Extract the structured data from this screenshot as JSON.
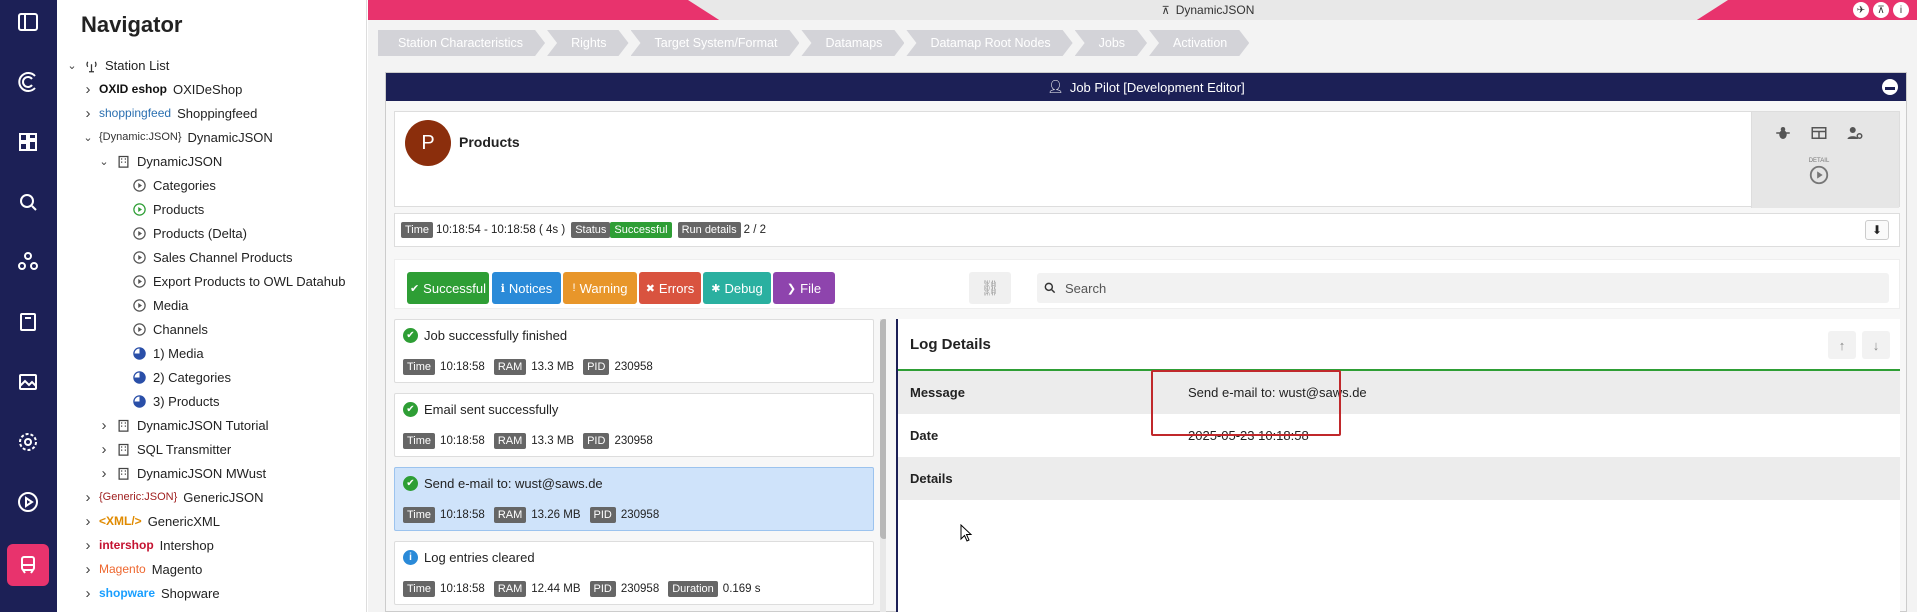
{
  "navigator": {
    "title": "Navigator",
    "tree": [
      {
        "label": "Station List",
        "depth": 0,
        "expanded": true,
        "icon": "antenna-icon",
        "logo": ""
      },
      {
        "label": "OXIDeShop",
        "depth": 1,
        "expanded": false,
        "icon": "",
        "logo": "OXID eshop"
      },
      {
        "label": "Shoppingfeed",
        "depth": 1,
        "expanded": false,
        "icon": "",
        "logo": "shoppingfeed"
      },
      {
        "label": "DynamicJSON",
        "depth": 1,
        "expanded": true,
        "icon": "",
        "logo": "{Dynamic:JSON}"
      },
      {
        "label": "DynamicJSON",
        "depth": 2,
        "expanded": true,
        "icon": "building-icon",
        "logo": ""
      },
      {
        "label": "Categories",
        "depth": 3,
        "icon": "play-circle-icon",
        "logo": ""
      },
      {
        "label": "Products",
        "depth": 3,
        "icon": "play-circle-icon",
        "logo": "",
        "active": true
      },
      {
        "label": "Products (Delta)",
        "depth": 3,
        "icon": "play-circle-icon",
        "logo": ""
      },
      {
        "label": "Sales Channel Products",
        "depth": 3,
        "icon": "play-circle-icon",
        "logo": ""
      },
      {
        "label": "Export Products to OWL Datahub",
        "depth": 3,
        "icon": "play-circle-icon",
        "logo": ""
      },
      {
        "label": "Media",
        "depth": 3,
        "icon": "play-circle-icon",
        "logo": ""
      },
      {
        "label": "Channels",
        "depth": 3,
        "icon": "play-circle-icon",
        "logo": ""
      },
      {
        "label": "1) Media",
        "depth": 3,
        "icon": "pie-icon",
        "logo": ""
      },
      {
        "label": "2) Categories",
        "depth": 3,
        "icon": "pie-icon",
        "logo": ""
      },
      {
        "label": "3) Products",
        "depth": 3,
        "icon": "pie-icon",
        "logo": ""
      },
      {
        "label": "DynamicJSON Tutorial",
        "depth": 2,
        "expanded": false,
        "icon": "building-icon",
        "logo": ""
      },
      {
        "label": "SQL Transmitter",
        "depth": 2,
        "expanded": false,
        "icon": "building-icon",
        "logo": ""
      },
      {
        "label": "DynamicJSON MWust",
        "depth": 2,
        "expanded": false,
        "icon": "building-icon",
        "logo": ""
      },
      {
        "label": "GenericJSON",
        "depth": 1,
        "expanded": false,
        "icon": "",
        "logo": "{Generic:JSON}"
      },
      {
        "label": "GenericXML",
        "depth": 1,
        "expanded": false,
        "icon": "",
        "logo": "<XML/>"
      },
      {
        "label": "Intershop",
        "depth": 1,
        "expanded": false,
        "icon": "",
        "logo": "intershop"
      },
      {
        "label": "Magento",
        "depth": 1,
        "expanded": false,
        "icon": "",
        "logo": "Magento"
      },
      {
        "label": "Shopware",
        "depth": 1,
        "expanded": false,
        "icon": "",
        "logo": "shopware"
      }
    ]
  },
  "topbar": {
    "title": "DynamicJSON"
  },
  "steps": [
    "Station Characteristics",
    "Rights",
    "Target System/Format",
    "Datamaps",
    "Datamap Root Nodes",
    "Jobs",
    "Activation"
  ],
  "panel": {
    "title": "Job Pilot [Development Editor]"
  },
  "job": {
    "avatar": "P",
    "title": "Products",
    "tools": {
      "detail_label": "DETAIL"
    },
    "meta": {
      "time_label": "Time",
      "time_value": "10:18:54 - 10:18:58 ( 4s )",
      "status_label": "Status",
      "status_value": "Successful",
      "run_label": "Run details",
      "run_value": "2 / 2"
    }
  },
  "filters": [
    {
      "label": "Successful",
      "color": "#2e9e35",
      "icon": "✔"
    },
    {
      "label": "Notices",
      "color": "#2a8ad8",
      "icon": "ℹ"
    },
    {
      "label": "Warning",
      "color": "#e8962a",
      "icon": "!"
    },
    {
      "label": "Errors",
      "color": "#d9533f",
      "icon": "✖"
    },
    {
      "label": "Debug",
      "color": "#2ab0a0",
      "icon": "✱"
    },
    {
      "label": "File",
      "color": "#8e44ad",
      "icon": "❯"
    }
  ],
  "search": {
    "placeholder": "Search"
  },
  "entries": [
    {
      "type": "ok",
      "text": "Job successfully finished",
      "meta": [
        [
          "Time",
          "10:18:58"
        ],
        [
          "RAM",
          "13.3 MB"
        ],
        [
          "PID",
          "230958"
        ]
      ],
      "selected": false
    },
    {
      "type": "ok",
      "text": "Email sent successfully",
      "meta": [
        [
          "Time",
          "10:18:58"
        ],
        [
          "RAM",
          "13.3 MB"
        ],
        [
          "PID",
          "230958"
        ]
      ],
      "selected": false
    },
    {
      "type": "ok",
      "text": "Send e-mail to: wust@saws.de",
      "meta": [
        [
          "Time",
          "10:18:58"
        ],
        [
          "RAM",
          "13.26 MB"
        ],
        [
          "PID",
          "230958"
        ]
      ],
      "selected": true
    },
    {
      "type": "info",
      "text": "Log entries cleared",
      "meta": [
        [
          "Time",
          "10:18:58"
        ],
        [
          "RAM",
          "12.44 MB"
        ],
        [
          "PID",
          "230958"
        ],
        [
          "Duration",
          "0.169 s"
        ]
      ],
      "selected": false
    }
  ],
  "details": {
    "title": "Log Details",
    "rows": [
      {
        "key": "Message",
        "value": "Send e-mail to: wust@saws.de"
      },
      {
        "key": "Date",
        "value": "2025-05-23 10:18:58"
      },
      {
        "key": "Details",
        "value": ""
      }
    ]
  }
}
